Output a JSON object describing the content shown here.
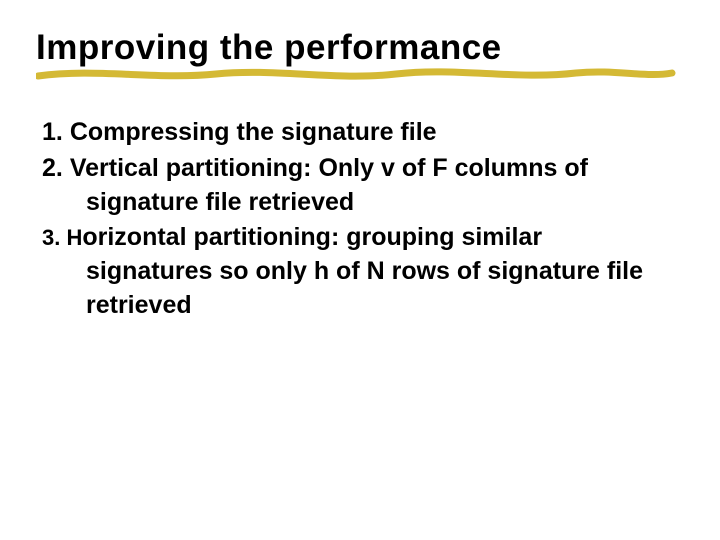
{
  "title": "Improving the performance",
  "items": [
    {
      "num": "1.",
      "text": "Compressing the signature file"
    },
    {
      "num": "2.",
      "text": "Vertical partitioning: Only v of F columns of signature file retrieved"
    },
    {
      "num_prefix": "3. H",
      "text": "orizontal partitioning: grouping similar signatures so only h of N rows of signature file retrieved"
    }
  ],
  "colors": {
    "underline": "#d4b935"
  }
}
